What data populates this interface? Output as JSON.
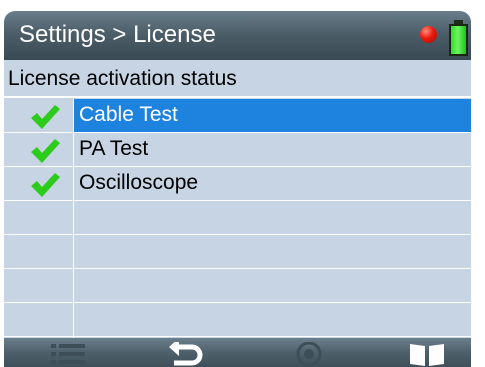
{
  "header": {
    "title": "Settings > License",
    "status_color": "#ea1b0e",
    "battery_color": "#2be028"
  },
  "section": {
    "title": "License activation status"
  },
  "licenses": [
    {
      "label": "Cable Test",
      "activated": true,
      "selected": true
    },
    {
      "label": "PA Test",
      "activated": true,
      "selected": false
    },
    {
      "label": "Oscilloscope",
      "activated": true,
      "selected": false
    },
    {
      "label": "",
      "activated": false,
      "selected": false
    },
    {
      "label": "",
      "activated": false,
      "selected": false
    },
    {
      "label": "",
      "activated": false,
      "selected": false
    },
    {
      "label": "",
      "activated": false,
      "selected": false
    }
  ],
  "colors": {
    "selection": "#1d83de",
    "check": "#2dcc1c",
    "background": "#c6d4e3"
  },
  "toolbar": {
    "icons": [
      "list-icon",
      "back-arrow-icon",
      "touch-icon",
      "book-icon"
    ]
  }
}
